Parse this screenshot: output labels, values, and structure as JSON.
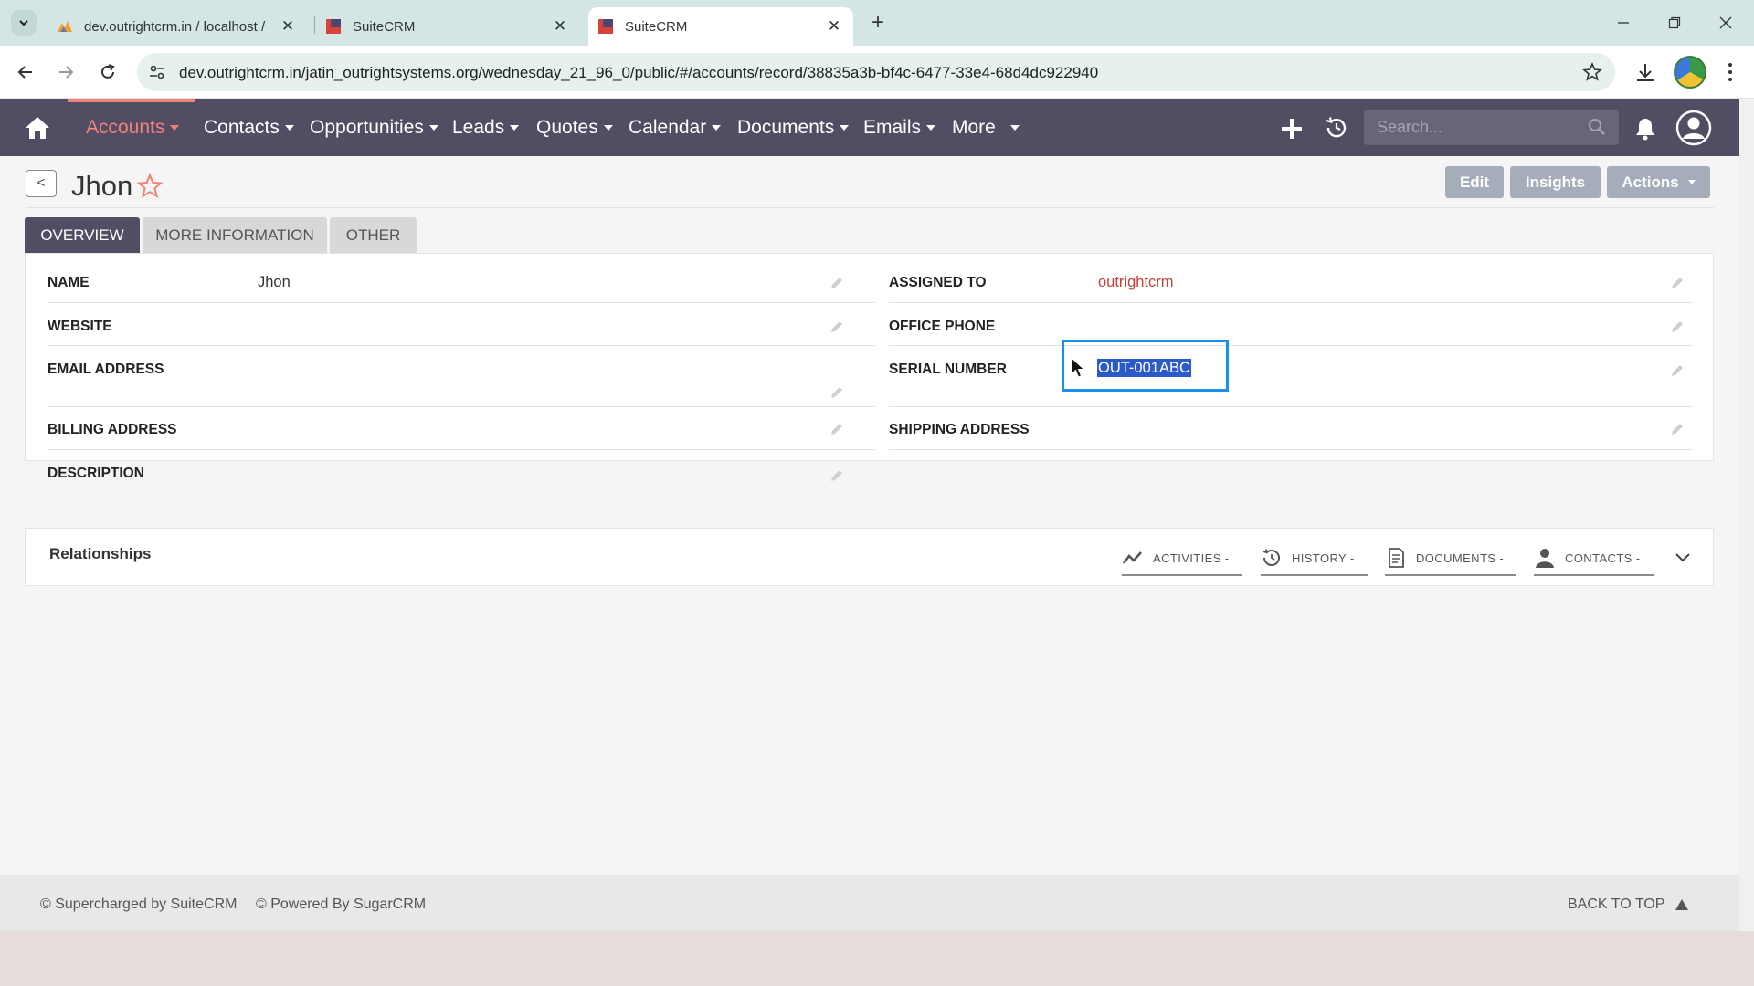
{
  "browser": {
    "tabs": [
      {
        "title": "dev.outrightcrm.in / localhost /"
      },
      {
        "title": "SuiteCRM"
      },
      {
        "title": "SuiteCRM"
      }
    ],
    "url": "dev.outrightcrm.in/jatin_outrightsystems.org/wednesday_21_96_0/public/#/accounts/record/38835a3b-bf4c-6477-33e4-68d4dc922940"
  },
  "nav": {
    "items": [
      {
        "label": "Accounts"
      },
      {
        "label": "Contacts"
      },
      {
        "label": "Opportunities"
      },
      {
        "label": "Leads"
      },
      {
        "label": "Quotes"
      },
      {
        "label": "Calendar"
      },
      {
        "label": "Documents"
      },
      {
        "label": "Emails"
      },
      {
        "label": "More"
      }
    ],
    "search_placeholder": "Search..."
  },
  "record": {
    "title": "Jhon",
    "buttons": {
      "edit": "Edit",
      "insights": "Insights",
      "actions": "Actions"
    },
    "tabs": [
      {
        "label": "OVERVIEW"
      },
      {
        "label": "MORE INFORMATION"
      },
      {
        "label": "OTHER"
      }
    ],
    "fields": {
      "name": {
        "label": "NAME",
        "value": "Jhon"
      },
      "website": {
        "label": "WEBSITE",
        "value": ""
      },
      "email": {
        "label": "EMAIL ADDRESS",
        "value": ""
      },
      "billing": {
        "label": "BILLING ADDRESS",
        "value": ""
      },
      "description": {
        "label": "DESCRIPTION",
        "value": ""
      },
      "assigned": {
        "label": "ASSIGNED TO",
        "value": "outrightcrm"
      },
      "phone": {
        "label": "OFFICE PHONE",
        "value": ""
      },
      "serial": {
        "label": "SERIAL NUMBER",
        "value": "OUT-001ABC"
      },
      "shipping": {
        "label": "SHIPPING ADDRESS",
        "value": ""
      }
    }
  },
  "relationships": {
    "title": "Relationships",
    "tabs": [
      {
        "label": "ACTIVITIES -"
      },
      {
        "label": "HISTORY -"
      },
      {
        "label": "DOCUMENTS -"
      },
      {
        "label": "CONTACTS -"
      }
    ]
  },
  "footer": {
    "supercharged": "© Supercharged by SuiteCRM",
    "powered": "© Powered By SugarCRM",
    "back_to_top": "BACK TO TOP"
  },
  "colors": {
    "nav_bg": "#534d64",
    "accent": "#f08377",
    "button": "#a5adbb",
    "selection": "#2c5ac9",
    "focus_outline": "#1a90e8"
  }
}
